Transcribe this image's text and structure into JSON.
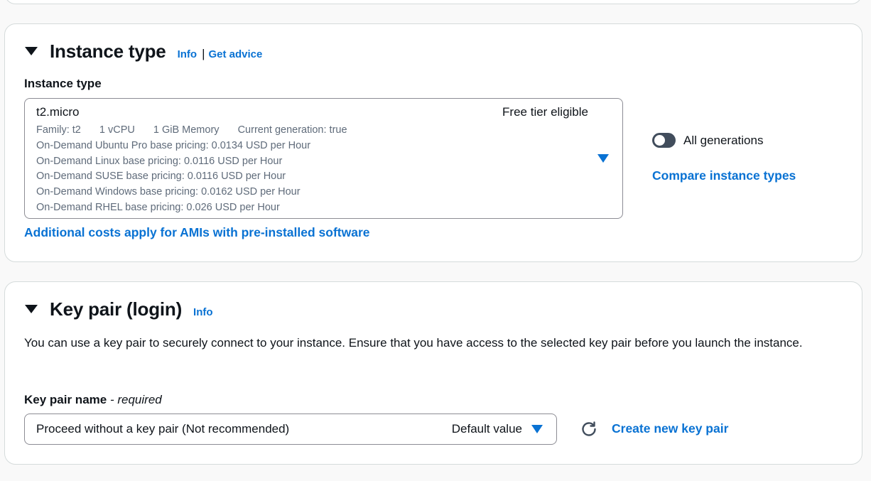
{
  "instance_type_section": {
    "title": "Instance type",
    "info_label": "Info",
    "separator": "|",
    "get_advice_label": "Get advice",
    "field_label": "Instance type",
    "selected": {
      "name": "t2.micro",
      "tag": "Free tier eligible",
      "family": "Family: t2",
      "vcpu": "1 vCPU",
      "memory": "1 GiB Memory",
      "generation": "Current generation: true",
      "pricing": [
        "On-Demand Ubuntu Pro base pricing: 0.0134 USD per Hour",
        "On-Demand Linux base pricing: 0.0116 USD per Hour",
        "On-Demand SUSE base pricing: 0.0116 USD per Hour",
        "On-Demand Windows base pricing: 0.0162 USD per Hour",
        "On-Demand RHEL base pricing: 0.026 USD per Hour"
      ]
    },
    "toggle_label": "All generations",
    "toggle_on": false,
    "compare_link": "Compare instance types",
    "additional_costs_link": "Additional costs apply for AMIs with pre-installed software"
  },
  "key_pair_section": {
    "title": "Key pair (login)",
    "info_label": "Info",
    "description": "You can use a key pair to securely connect to your instance. Ensure that you have access to the selected key pair before you launch the instance.",
    "field_label": "Key pair name",
    "field_label_suffix": "- required",
    "selected_value": "Proceed without a key pair (Not recommended)",
    "default_tag": "Default value",
    "create_link": "Create new key pair"
  },
  "icons": {
    "caret": "caret-down-icon",
    "dropdown": "dropdown-arrow-icon",
    "refresh": "refresh-icon"
  },
  "colors": {
    "link": "#0972d3",
    "text": "#0f141a",
    "muted": "#5f6b7a",
    "border": "#8c8c94",
    "toggle_off": "#414d5c"
  }
}
